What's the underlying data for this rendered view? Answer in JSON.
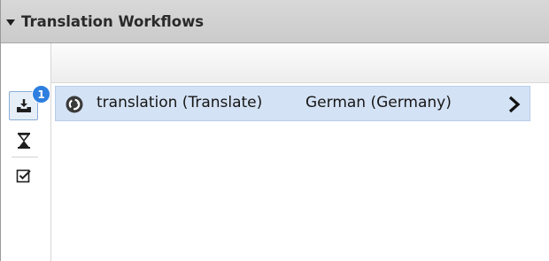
{
  "panel": {
    "title": "Translation Workflows"
  },
  "rail": {
    "badge_count": "1",
    "items": [
      {
        "icon": "inbox-download-icon",
        "active": true
      },
      {
        "icon": "hourglass-icon",
        "active": false
      },
      {
        "icon": "checkbox-checked-icon",
        "active": false
      }
    ]
  },
  "list": {
    "rows": [
      {
        "icon": "workflow-sync-icon",
        "task": "translation (Translate)",
        "language": "German (Germany)",
        "action_icon": "chevron-right-icon"
      }
    ]
  },
  "colors": {
    "accent": "#2e7fe0",
    "row_selected_bg": "#d4e2f5",
    "header_bg": "#d0d0d0"
  }
}
